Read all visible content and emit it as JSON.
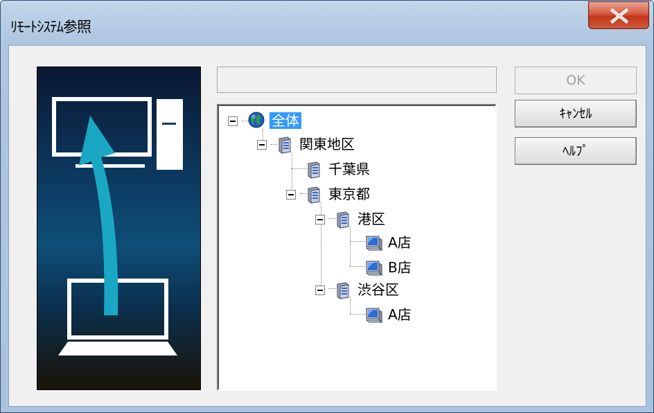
{
  "window": {
    "title": "ﾘﾓｰﾄｼｽﾃﾑ参照",
    "close_label": "×"
  },
  "path_field": {
    "value": ""
  },
  "buttons": {
    "ok": "OK",
    "cancel": "ｷｬﾝｾﾙ",
    "help": "ﾍﾙﾌﾟ"
  },
  "tree": {
    "root": "全体",
    "kanto": "関東地区",
    "chiba": "千葉県",
    "tokyo": "東京都",
    "minato": "港区",
    "minato_a": "A店",
    "minato_b": "B店",
    "shibuya": "渋谷区",
    "shibuya_a": "A店"
  },
  "colors": {
    "selection": "#3399ff",
    "accent_arrow": "#1aa7c4"
  }
}
